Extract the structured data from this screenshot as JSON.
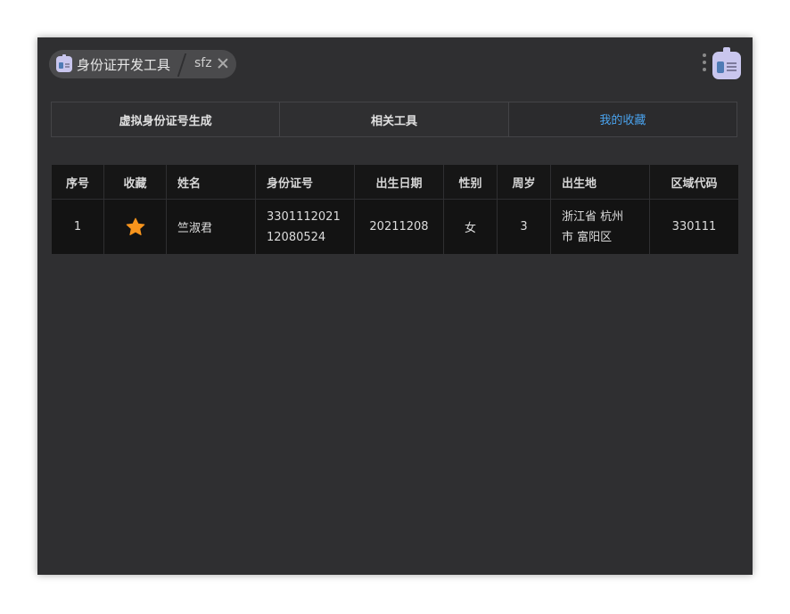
{
  "header": {
    "app_title": "身份证开发工具",
    "sub_label": "sfz"
  },
  "tabs": [
    {
      "label": "虚拟身份证号生成"
    },
    {
      "label": "相关工具"
    },
    {
      "label": "我的收藏"
    }
  ],
  "table": {
    "columns": [
      "序号",
      "收藏",
      "姓名",
      "身份证号",
      "出生日期",
      "性别",
      "周岁",
      "出生地",
      "区域代码"
    ],
    "rows": [
      {
        "index": "1",
        "name": "竺淑君",
        "id_line1": "3301112021",
        "id_line2": "12080524",
        "birth_date": "20211208",
        "gender": "女",
        "age": "3",
        "birthplace_line1": "浙江省 杭州",
        "birthplace_line2": "市 富阳区",
        "region_code": "330111"
      }
    ]
  },
  "colors": {
    "window_bg": "#2f2f31",
    "accent": "#4aa3ee",
    "star": "#f7941d",
    "icon": "#c9c6ee"
  }
}
